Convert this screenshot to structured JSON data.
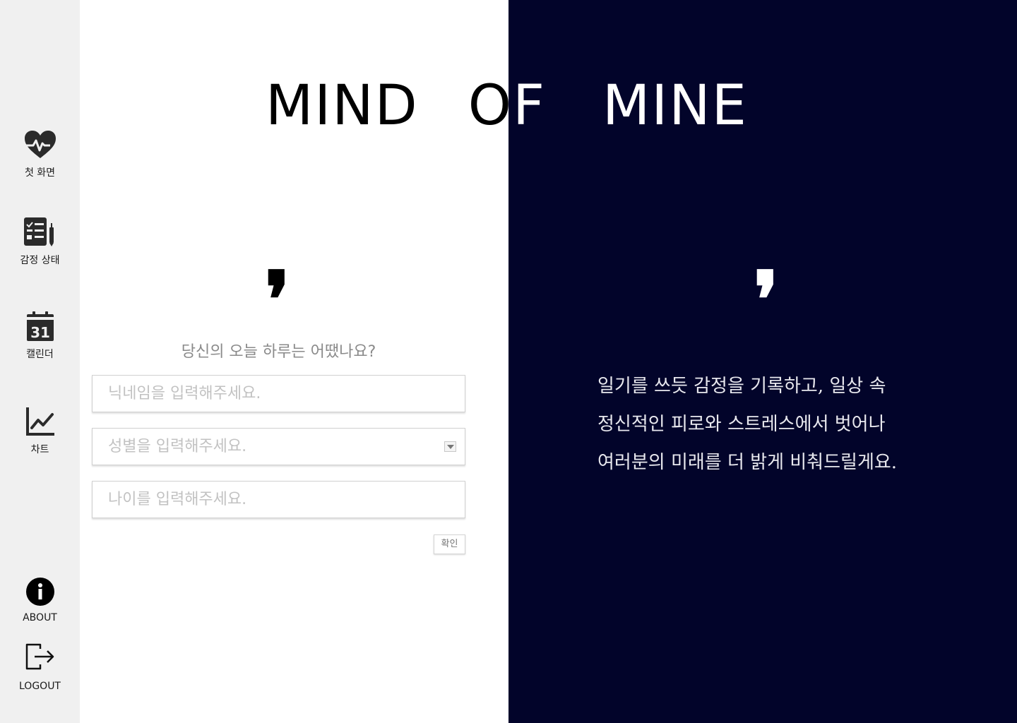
{
  "app": {
    "title_words": [
      "MIND",
      "OF",
      "MINE"
    ]
  },
  "sidebar": {
    "items": [
      {
        "label": "첫 화면",
        "icon": "heartbeat-icon"
      },
      {
        "label": "감정 상태",
        "icon": "checklist-icon"
      },
      {
        "label": "캘린더",
        "icon": "calendar-icon",
        "icon_text": "31"
      },
      {
        "label": "차트",
        "icon": "line-chart-icon"
      }
    ],
    "about_label": "ABOUT",
    "logout_label": "LOGOUT"
  },
  "form": {
    "quote_mark": "❜",
    "question": "당신의 오늘 하루는 어땠나요?",
    "nickname_placeholder": "닉네임을 입력해주세요.",
    "gender_placeholder": "성별을 입력해주세요.",
    "age_placeholder": "나이를 입력해주세요.",
    "confirm_label": "확인"
  },
  "intro": {
    "quote_mark": "❜",
    "lines": [
      "일기를 쓰듯 감정을 기록하고, 일상 속",
      "정신적인 피로와 스트레스에서 벗어나",
      "여러분의 미래를 더 밝게 비춰드릴게요."
    ]
  },
  "colors": {
    "sidebar_bg": "#f0f0f0",
    "right_panel_bg": "#02042a",
    "icon_dark": "#2b2b2b"
  }
}
